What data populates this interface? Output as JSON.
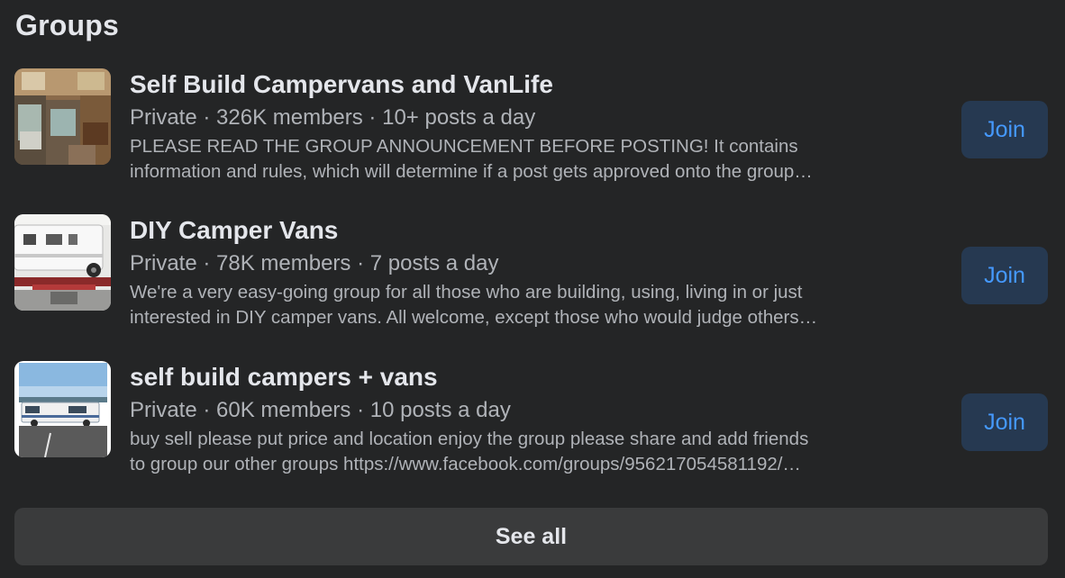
{
  "section": {
    "title": "Groups"
  },
  "groups": [
    {
      "name": "Self Build Campervans and VanLife",
      "meta": "Private · 326K members · 10+ posts a day",
      "desc_line1": "PLEASE READ THE GROUP ANNOUNCEMENT BEFORE POSTING! It contains",
      "desc_line2": "information and rules, which will determine if a post gets approved onto the group…",
      "join_label": "Join"
    },
    {
      "name": "DIY Camper Vans",
      "meta": "Private · 78K members · 7 posts a day",
      "desc_line1": "We're a very easy-going group for all those who are building, using, living in or just",
      "desc_line2": "interested in DIY camper vans. All welcome, except those who would judge others…",
      "join_label": "Join"
    },
    {
      "name": "self build campers + vans",
      "meta": "Private · 60K members · 10 posts a day",
      "desc_line1": "buy sell please put price and location enjoy the group please share and add friends",
      "desc_line2": "to group our other groups https://www.facebook.com/groups/956217054581192/…",
      "join_label": "Join"
    }
  ],
  "see_all_label": "See all",
  "colors": {
    "background": "#242526",
    "primary_text": "#e4e6eb",
    "secondary_text": "#b0b3b8",
    "join_bg": "#263951",
    "join_text": "#4599ff",
    "see_all_bg": "#3a3b3c"
  }
}
